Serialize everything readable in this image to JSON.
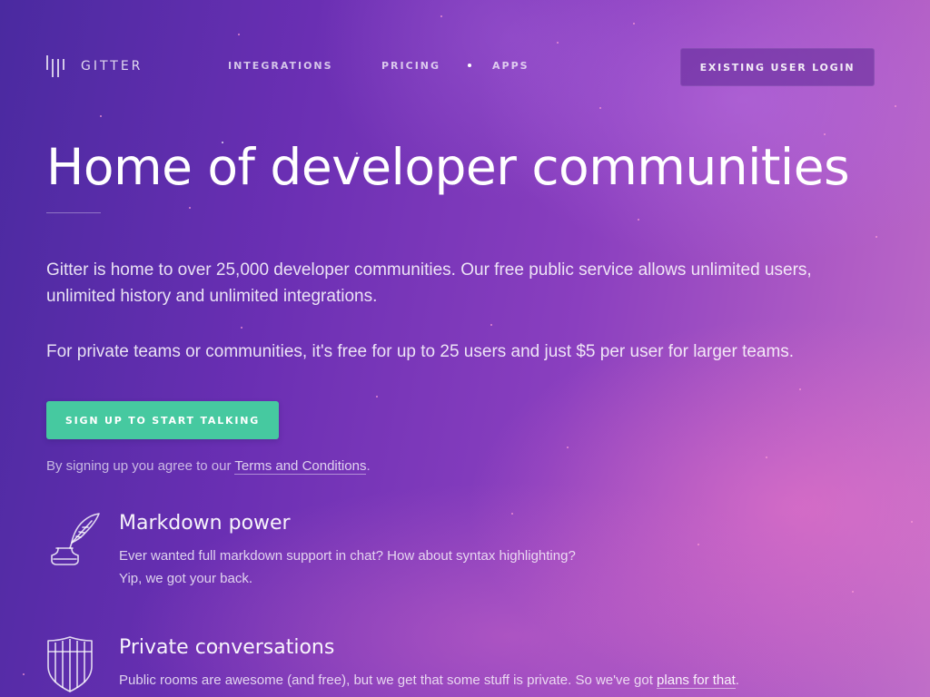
{
  "header": {
    "logo_text": "GITTER",
    "nav": [
      {
        "label": "INTEGRATIONS"
      },
      {
        "label": "PRICING"
      },
      {
        "label": "APPS"
      }
    ],
    "login_label": "EXISTING USER LOGIN"
  },
  "hero": {
    "title": "Home of developer communities",
    "description_1": "Gitter is home to over 25,000 developer communities. Our free public service allows unlimited users, unlimited history and unlimited integrations.",
    "description_2": "For private teams or communities, it's free for up to 25 users and just $5 per user for larger teams.",
    "signup_label": "SIGN UP TO START TALKING",
    "terms_prefix": "By signing up you agree to our ",
    "terms_link": "Terms and Conditions",
    "terms_suffix": "."
  },
  "features": [
    {
      "icon": "quill-ink-icon",
      "title": "Markdown power",
      "line_1": "Ever wanted full markdown support in chat? How about syntax highlighting?",
      "line_2": "Yip, we got your back."
    },
    {
      "icon": "shield-icon",
      "title": "Private conversations",
      "line_1_prefix": "Public rooms are awesome (and free), but we get that some stuff is private. So we've got ",
      "line_1_link": "plans for that",
      "line_1_suffix": "."
    }
  ],
  "colors": {
    "accent_button": "#46c9a0",
    "background_start": "#4a2aa0",
    "background_end": "#c06ec8"
  }
}
